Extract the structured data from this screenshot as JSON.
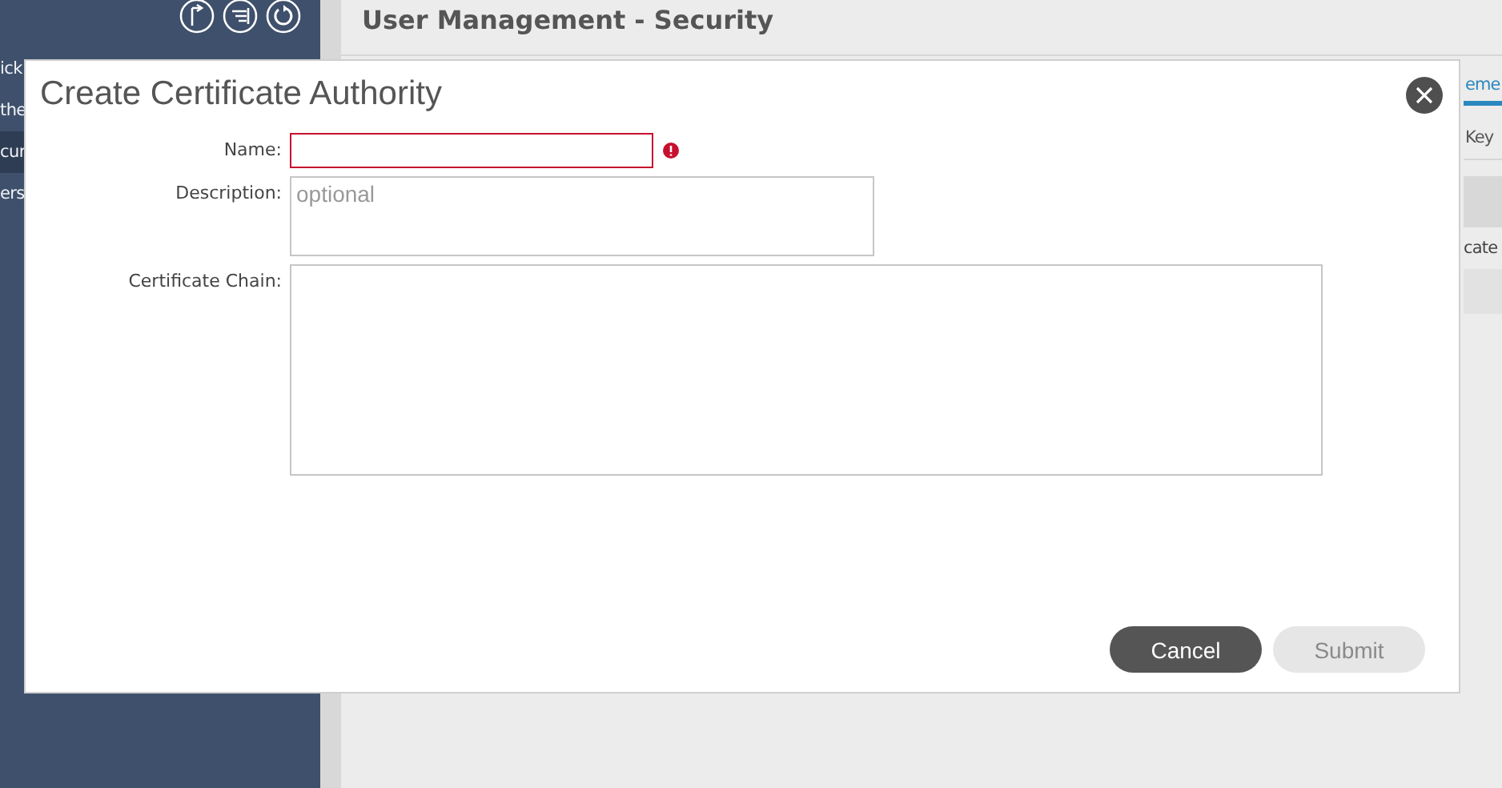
{
  "sidebar": {
    "items": [
      {
        "label": "ick",
        "selected": false
      },
      {
        "label": "the",
        "selected": false
      },
      {
        "label": "cur",
        "selected": true
      },
      {
        "label": "ers",
        "selected": false
      }
    ]
  },
  "page": {
    "title": "User Management - Security",
    "tabs": [
      {
        "label": "eme",
        "selected": true
      },
      {
        "label": "Key",
        "selected": false
      }
    ],
    "table": {
      "rows": [
        "cate"
      ]
    }
  },
  "dialog": {
    "title": "Create Certificate Authority",
    "fields": [
      {
        "label": "Name:",
        "kind": "text",
        "invalid": true
      },
      {
        "label": "Description:",
        "kind": "textarea",
        "placeholder": "optional"
      },
      {
        "label": "Certificate Chain:",
        "kind": "textarea-large"
      }
    ],
    "buttons": [
      {
        "label": "Cancel",
        "disabled": false
      },
      {
        "label": "Submit",
        "disabled": true
      }
    ]
  }
}
